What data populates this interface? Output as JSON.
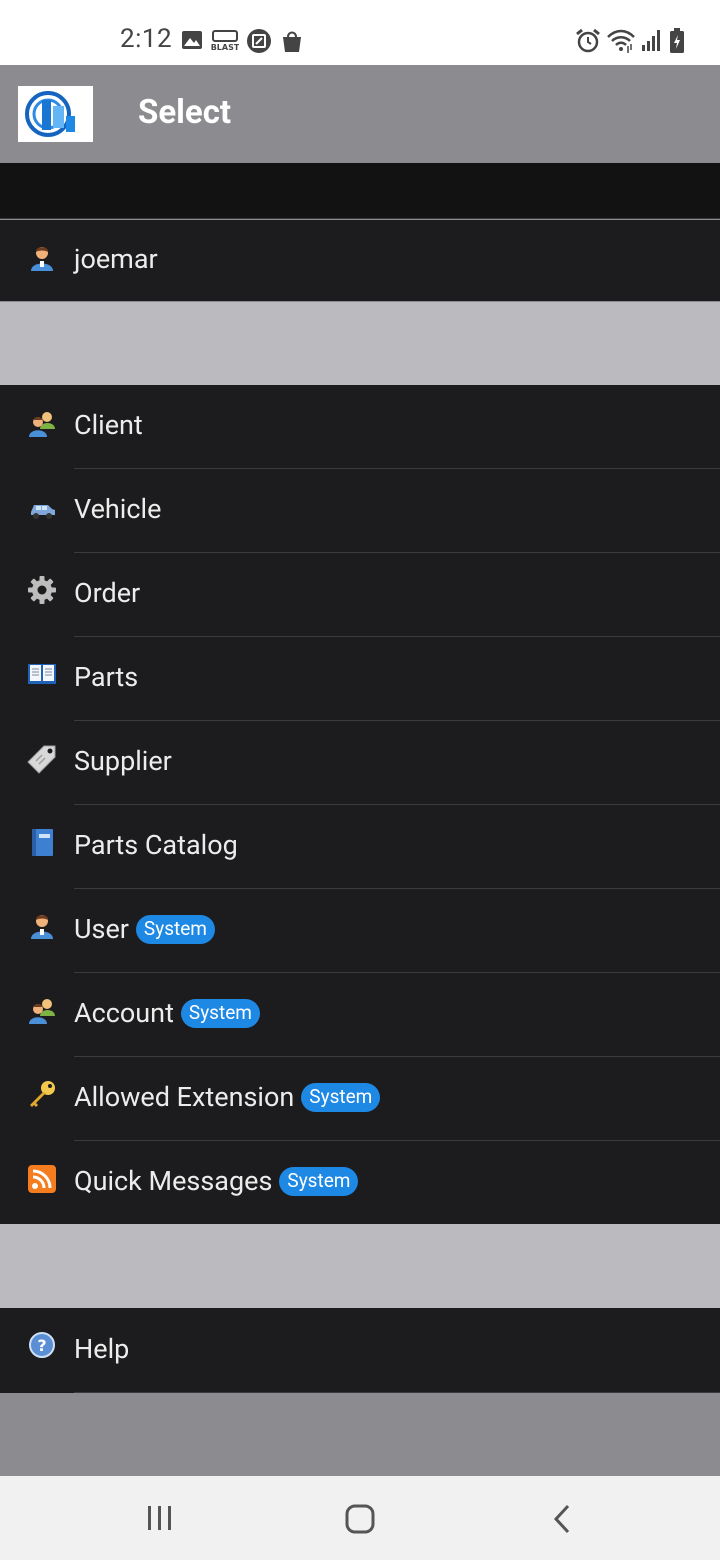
{
  "status_bar": {
    "time": "2:12",
    "left_icons": [
      "image-icon",
      "blast-icon",
      "edit-box-icon",
      "shopping-bag-icon"
    ],
    "right_icons": [
      "alarm-icon",
      "wifi-icon",
      "signal-icon",
      "battery-icon"
    ]
  },
  "header": {
    "title": "Select",
    "logo": "app-logo"
  },
  "user": {
    "name": "joemar",
    "icon": "user-icon"
  },
  "menu": {
    "items": [
      {
        "label": "Client",
        "icon": "client-icon",
        "badge": ""
      },
      {
        "label": "Vehicle",
        "icon": "car-icon",
        "badge": ""
      },
      {
        "label": "Order",
        "icon": "gear-icon",
        "badge": ""
      },
      {
        "label": "Parts",
        "icon": "book-icon",
        "badge": ""
      },
      {
        "label": "Supplier",
        "icon": "tag-icon",
        "badge": ""
      },
      {
        "label": "Parts Catalog",
        "icon": "catalog-icon",
        "badge": ""
      },
      {
        "label": "User",
        "icon": "user-icon",
        "badge": "System"
      },
      {
        "label": "Account",
        "icon": "group-icon",
        "badge": "System"
      },
      {
        "label": "Allowed Extension",
        "icon": "key-icon",
        "badge": "System"
      },
      {
        "label": "Quick Messages",
        "icon": "rss-icon",
        "badge": "System"
      }
    ]
  },
  "help": {
    "label": "Help",
    "icon": "help-icon"
  },
  "nav_bar": {
    "icons": [
      "recent-apps-icon",
      "home-icon",
      "back-icon"
    ]
  },
  "colors": {
    "header_bg": "#8c8b90",
    "row_bg": "#1c1c1e",
    "badge_bg": "#1e88e5",
    "separator": "#bbbabf"
  }
}
